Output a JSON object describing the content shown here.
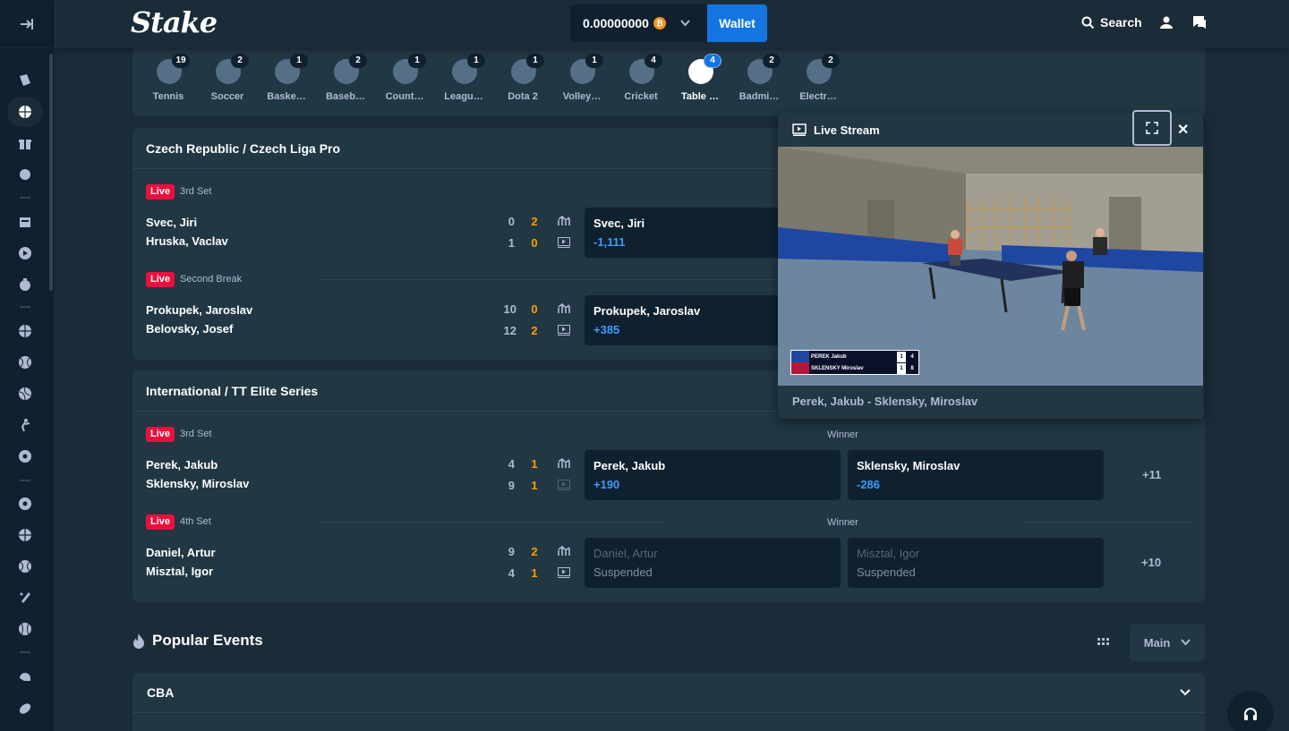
{
  "header": {
    "logo": "Stake",
    "balance": "0.00000000",
    "currency_icon": "bitcoin-icon",
    "wallet_label": "Wallet",
    "search_label": "Search"
  },
  "sports_tabs": [
    {
      "label": "Tennis",
      "count": "19",
      "icon": "tennis-icon"
    },
    {
      "label": "Soccer",
      "count": "2",
      "icon": "soccer-icon"
    },
    {
      "label": "Baske…",
      "count": "1",
      "icon": "basketball-icon"
    },
    {
      "label": "Baseb…",
      "count": "2",
      "icon": "baseball-icon"
    },
    {
      "label": "Count…",
      "count": "1",
      "icon": "counter-strike-icon"
    },
    {
      "label": "Leagu…",
      "count": "1",
      "icon": "league-of-legends-icon"
    },
    {
      "label": "Dota 2",
      "count": "1",
      "icon": "dota2-icon"
    },
    {
      "label": "Volley…",
      "count": "1",
      "icon": "volleyball-icon"
    },
    {
      "label": "Cricket",
      "count": "4",
      "icon": "cricket-icon"
    },
    {
      "label": "Table …",
      "count": "4",
      "icon": "table-tennis-icon",
      "active": true
    },
    {
      "label": "Badmi…",
      "count": "2",
      "icon": "badminton-icon"
    },
    {
      "label": "Electr…",
      "count": "2",
      "icon": "esoccer-icon"
    }
  ],
  "leagues": [
    {
      "title": "Czech Republic / Czech Liga Pro",
      "matches": [
        {
          "live": "Live",
          "status": "3rd Set",
          "team1": "Svec, Jiri",
          "team2": "Hruska, Vaclav",
          "score1_sets": "0",
          "score1_games": "2",
          "score2_sets": "1",
          "score2_games": "0",
          "odds1_name": "Svec, Jiri",
          "odds1_value": "-1,111"
        },
        {
          "live": "Live",
          "status": "Second Break",
          "team1": "Prokupek, Jaroslav",
          "team2": "Belovsky, Josef",
          "score1_sets": "10",
          "score1_games": "0",
          "score2_sets": "12",
          "score2_games": "2",
          "odds1_name": "Prokupek, Jaroslav",
          "odds1_value": "+385"
        }
      ]
    },
    {
      "title": "International / TT Elite Series",
      "matches": [
        {
          "live": "Live",
          "status": "3rd Set",
          "market": "Winner",
          "team1": "Perek, Jakub",
          "team2": "Sklensky, Miroslav",
          "score1_sets": "4",
          "score1_games": "1",
          "score2_sets": "9",
          "score2_games": "1",
          "odds1_name": "Perek, Jakub",
          "odds1_value": "+190",
          "odds2_name": "Sklensky, Miroslav",
          "odds2_value": "-286",
          "more": "+11"
        },
        {
          "live": "Live",
          "status": "4th Set",
          "market": "Winner",
          "team1": "Daniel, Artur",
          "team2": "Misztal, Igor",
          "score1_sets": "9",
          "score1_games": "2",
          "score2_sets": "4",
          "score2_games": "1",
          "odds1_name": "Daniel, Artur",
          "odds1_value": "Suspended",
          "odds2_name": "Misztal, Igor",
          "odds2_value": "Suspended",
          "more": "+10"
        }
      ]
    }
  ],
  "popular": {
    "title": "Popular Events",
    "view_select": "Main",
    "first_group": "CBA"
  },
  "stream": {
    "title": "Live Stream",
    "caption": "Perek, Jakub - Sklensky, Miroslav",
    "scoreboard": {
      "p1": "PEREK Jakub",
      "p1_sets": "1",
      "p1_points": "4",
      "p2": "SKLENSKY Miroslav",
      "p2_sets": "1",
      "p2_points": "8"
    }
  },
  "colors": {
    "bg": "#1a2c38",
    "panel": "#213743",
    "dark": "#0f212e",
    "accent": "#1475e1",
    "live": "#e9113c",
    "score": "#ff9d00",
    "odds": "#3e9bff"
  }
}
